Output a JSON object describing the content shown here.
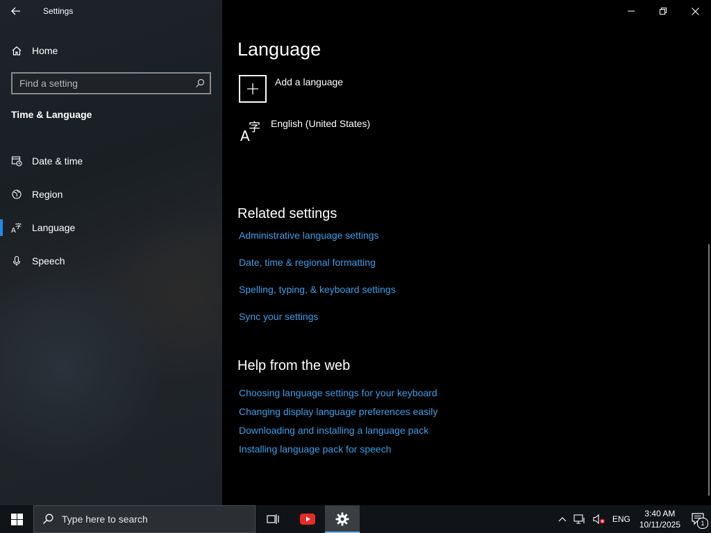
{
  "window": {
    "title": "Settings"
  },
  "sidebar": {
    "home_label": "Home",
    "search_placeholder": "Find a setting",
    "section_label": "Time & Language",
    "items": [
      {
        "label": "Date & time",
        "icon": "calendar-clock-icon"
      },
      {
        "label": "Region",
        "icon": "globe-icon"
      },
      {
        "label": "Language",
        "icon": "language-icon",
        "selected": true
      },
      {
        "label": "Speech",
        "icon": "microphone-icon"
      }
    ]
  },
  "main": {
    "title": "Language",
    "add_language_label": "Add a language",
    "installed_language": "English (United States)",
    "related_title": "Related settings",
    "related_links": [
      "Administrative language settings",
      "Date, time & regional formatting",
      "Spelling, typing, & keyboard settings",
      "Sync your settings"
    ],
    "help_title": "Help from the web",
    "help_links": [
      "Choosing language settings for your keyboard",
      "Changing display language preferences easily",
      "Downloading and installing a language pack",
      "Installing language pack for speech"
    ]
  },
  "taskbar": {
    "search_placeholder": "Type here to search",
    "language": "ENG",
    "time": "3:40 AM",
    "date": "10/11/2025",
    "notification_count": "1"
  },
  "colors": {
    "accent": "#1f8ce6",
    "link": "#3d9ee8"
  }
}
